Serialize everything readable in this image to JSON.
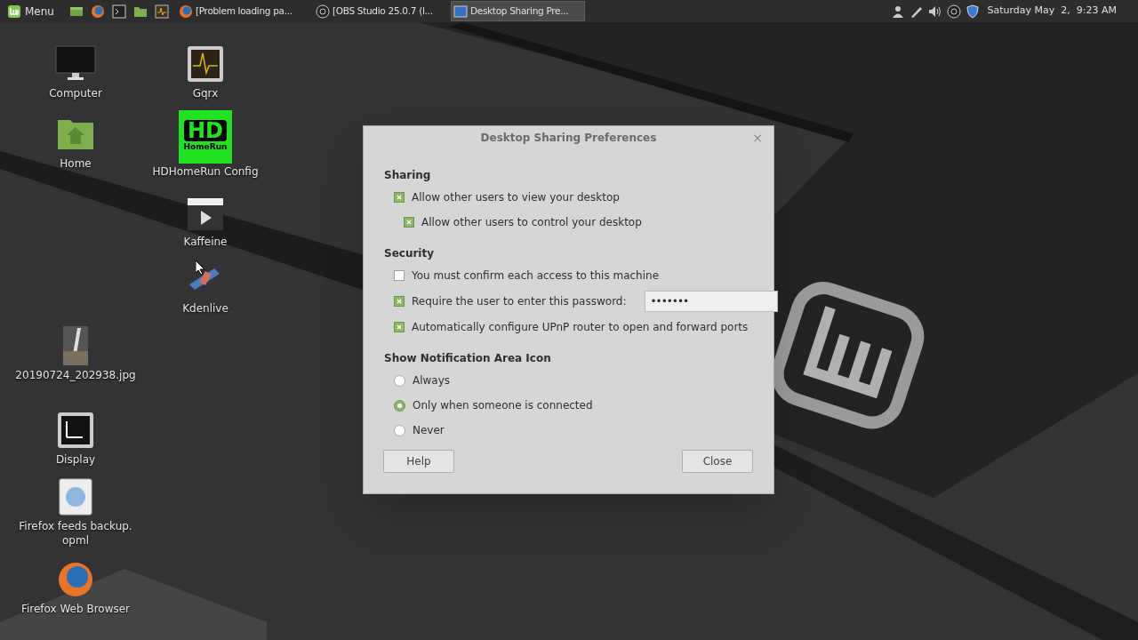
{
  "taskbar": {
    "menu_label": "Menu",
    "launchers": [
      {
        "kind": "desktop"
      },
      {
        "kind": "firefox"
      },
      {
        "kind": "terminal"
      },
      {
        "kind": "folder"
      },
      {
        "kind": "gqrx"
      }
    ],
    "windows": [
      {
        "kind": "firefox",
        "title": "[Problem loading pa...",
        "selected": false
      },
      {
        "kind": "obs",
        "title": "[OBS Studio 25.0.7 (l...",
        "selected": false
      },
      {
        "kind": "sharing",
        "title": "Desktop Sharing Pre...",
        "selected": true
      }
    ],
    "tray": [
      {
        "kind": "user"
      },
      {
        "kind": "pen"
      },
      {
        "kind": "volume"
      },
      {
        "kind": "obs"
      },
      {
        "kind": "shield"
      }
    ],
    "clock": "Saturday May  2,  9:23 AM"
  },
  "desktop_icons": [
    {
      "kind": "computer",
      "label": "Computer"
    },
    {
      "kind": "home",
      "label": "Home"
    },
    {
      "kind": "image",
      "label": "20190724_202938.jpg"
    },
    {
      "kind": "display",
      "label": "Display"
    },
    {
      "kind": "document",
      "label": "Firefox feeds backup. opml"
    },
    {
      "kind": "firefox",
      "label": "Firefox Web Browser"
    },
    {
      "kind": "gqrx",
      "label": "Gqrx"
    },
    {
      "kind": "hdhomerun",
      "label": "HDHomeRun Config",
      "logo_lines": [
        "HD",
        "HomeRun"
      ]
    },
    {
      "kind": "kaffeine",
      "label": "Kaffeine"
    },
    {
      "kind": "kdenlive",
      "label": "Kdenlive"
    }
  ],
  "dialog": {
    "title": "Desktop Sharing Preferences",
    "close": "×",
    "sections": [
      {
        "heading": "Sharing",
        "options": [
          {
            "kind": "checkbox",
            "label": "Allow other users to view your desktop",
            "checked": true,
            "children": [
              {
                "kind": "checkbox",
                "label": "Allow other users to control your desktop",
                "checked": true
              }
            ]
          }
        ]
      },
      {
        "heading": "Security",
        "options": [
          {
            "kind": "checkbox",
            "label": "You must confirm each access to this machine",
            "checked": false
          },
          {
            "kind": "password",
            "label": "Require the user to enter this password:",
            "checked": true,
            "value": "•••••••"
          },
          {
            "kind": "checkbox",
            "label": "Automatically configure UPnP router to open and forward ports",
            "checked": true
          }
        ]
      },
      {
        "heading": "Show Notification Area Icon",
        "options": [
          {
            "kind": "radio",
            "label": "Always",
            "selected": false
          },
          {
            "kind": "radio",
            "label": "Only when someone is connected",
            "selected": true
          },
          {
            "kind": "radio",
            "label": "Never",
            "selected": false
          }
        ]
      }
    ],
    "buttons": [
      "Help",
      "Close"
    ]
  }
}
